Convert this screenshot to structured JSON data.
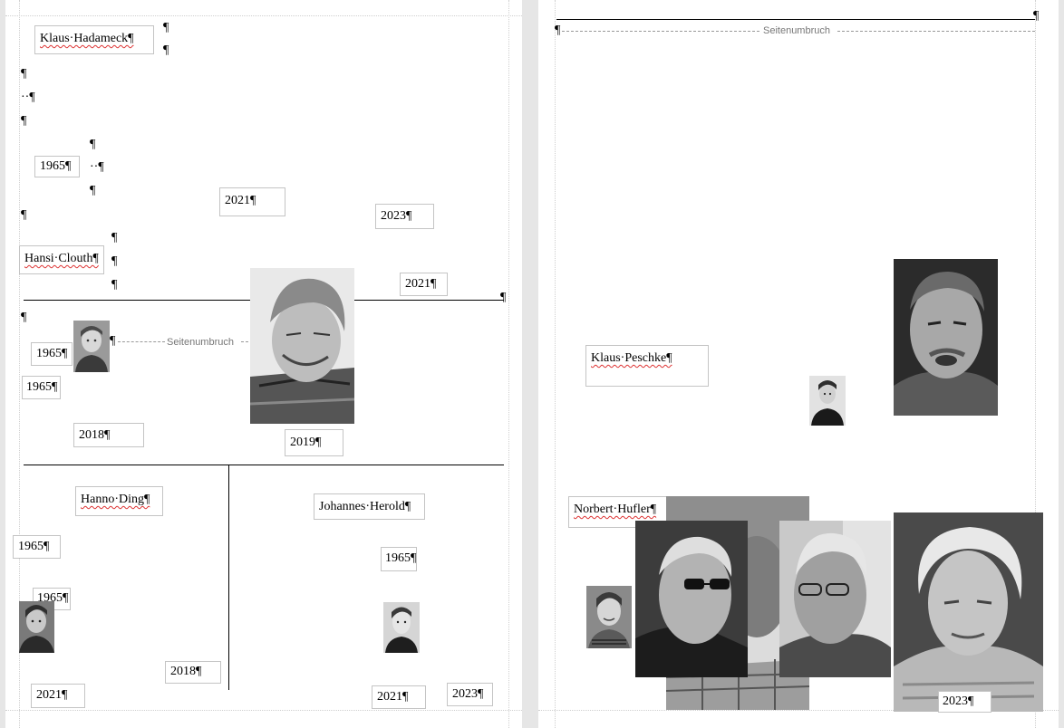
{
  "pilcrow": "¶",
  "dots_mark": "··¶",
  "page_break_label": "Seitenumbruch",
  "page1": {
    "names": {
      "klaus_hadameck": "Klaus·Hadameck¶",
      "hansi_clouth": "Hansi·Clouth¶",
      "hanno_ding": "Hanno·Ding¶",
      "johannes_herold": "Johannes·Herold¶"
    },
    "years": {
      "y1965_a": "1965¶",
      "y2021_a": "2021¶",
      "y2023_a": "2023¶",
      "y2021_b": "2021¶",
      "y1965_b": "1965¶",
      "y1965_c": "1965¶",
      "y2018_a": "2018¶",
      "y2019": "2019¶",
      "y1965_d": "1965¶",
      "y1965_e": "1965¶",
      "y2018_b": "2018¶",
      "y2021_c": "2021¶",
      "y1965_f": "1965¶",
      "y2021_d": "2021¶",
      "y2023_b": "2023¶"
    }
  },
  "page2": {
    "names": {
      "klaus_peschke": "Klaus·Peschke¶",
      "norbert_hufler": "Norbert·Hufler¶"
    },
    "years": {
      "y2023": "2023¶"
    }
  }
}
